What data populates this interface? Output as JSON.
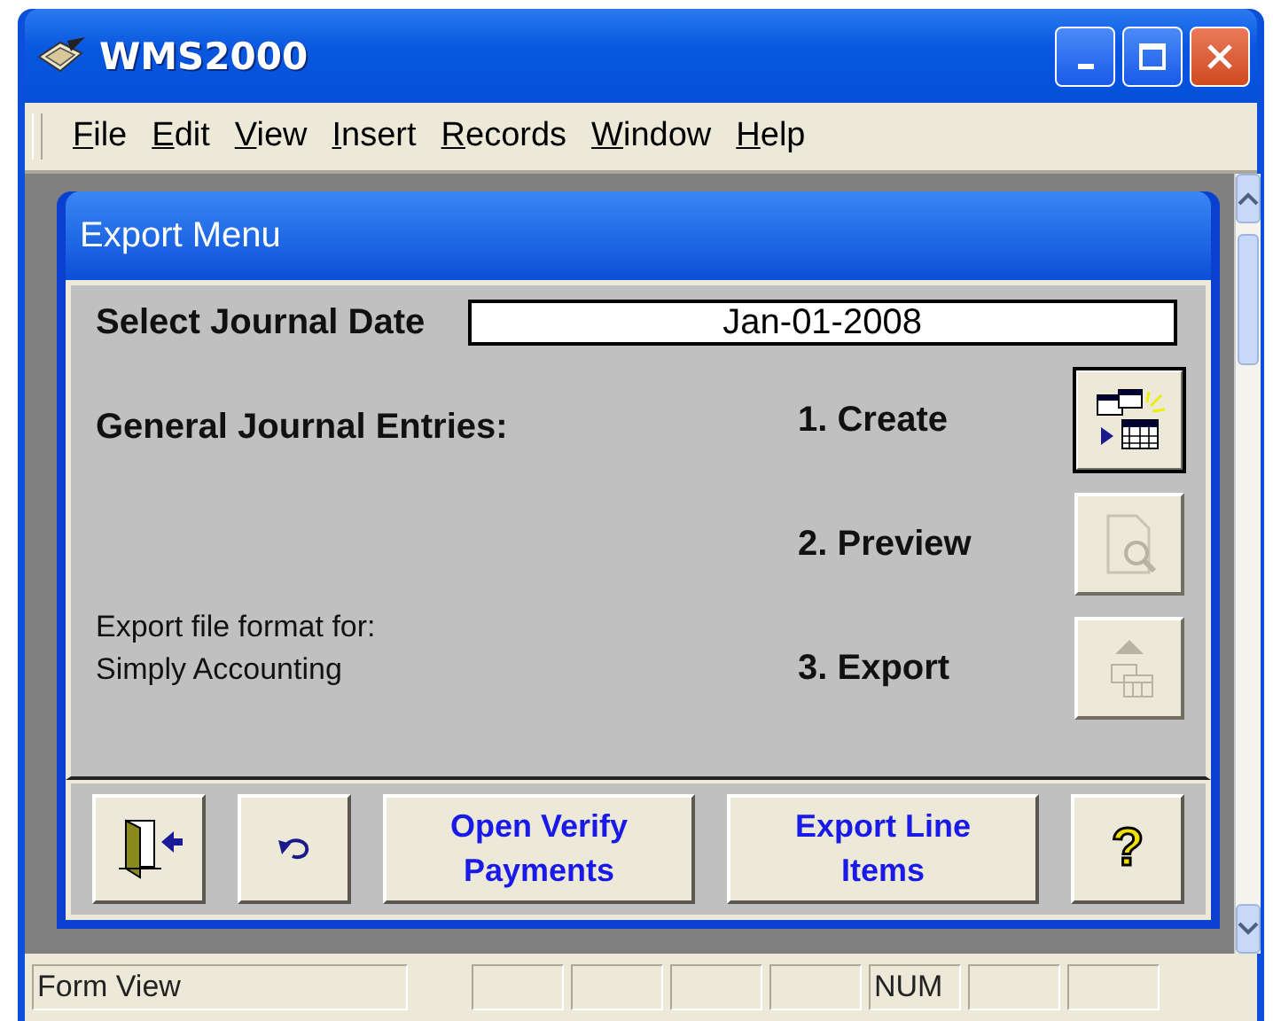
{
  "window": {
    "title": "WMS2000"
  },
  "menu": [
    "File",
    "Edit",
    "View",
    "Insert",
    "Records",
    "Window",
    "Help"
  ],
  "form": {
    "title": "Export Menu",
    "date_label": "Select Journal Date",
    "date_value": "Jan-01-2008",
    "section_label": "General Journal Entries:",
    "format_note": [
      "Export file format for:",
      "Simply Accounting"
    ],
    "steps": [
      {
        "label": "1. Create",
        "kind": "create",
        "disabled": false,
        "focused": true
      },
      {
        "label": "2. Preview",
        "kind": "preview",
        "disabled": true,
        "focused": false
      },
      {
        "label": "3. Export",
        "kind": "export",
        "disabled": true,
        "focused": false
      }
    ],
    "buttons": [
      {
        "kind": "exit"
      },
      {
        "kind": "undo"
      },
      {
        "kind": "text",
        "label": "Open Verify Payments"
      },
      {
        "kind": "text",
        "label": "Export Line Items"
      },
      {
        "kind": "help",
        "label": "?"
      }
    ]
  },
  "status_bar": {
    "text": "Form View",
    "num_indicator": "NUM"
  }
}
